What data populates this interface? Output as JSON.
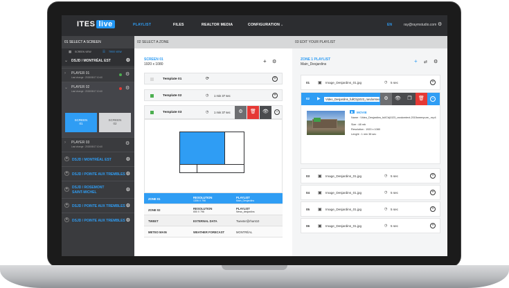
{
  "app": {
    "logo_main": "ITES",
    "logo_accent": "live"
  },
  "nav": {
    "items": [
      "PLAYLIST",
      "FILES",
      "REALTOR MEDIA",
      "CONFIGURATION"
    ],
    "lang": "EN",
    "email": "ray@raymstudio.com"
  },
  "col1": {
    "header": "01  SELECT A SCREEN",
    "toggle": [
      "SCREEN VIEW",
      "TREE VIEW"
    ],
    "top_site": "DSJD / MONTRÉAL EST",
    "players": [
      {
        "name": "PLAYER 01",
        "sub": "Last change : 2015/05/17 10:40",
        "status": "#4caf50"
      },
      {
        "name": "PLAYER 02",
        "sub": "Last change : 2015/05/17 10:40",
        "status": "#e53935"
      },
      {
        "name": "PLAYER 03",
        "sub": "Last change : 2015/05/17 10:40",
        "status": ""
      }
    ],
    "screens": [
      {
        "label": "SCREEN",
        "num": "01"
      },
      {
        "label": "SCREEN",
        "num": "02"
      }
    ],
    "sites": [
      "DSJD / MONTRÉAL EST",
      "DSJD / POINTE AUX TREMBLES",
      "DSJD / ROSEMONT SAINT-MICHEL",
      "DSJD / POINTE AUX TREMBLES",
      "DSJD / POINTE AUX TREMBLES"
    ]
  },
  "col2": {
    "header": "02  SELECT A ZONE",
    "screen_title": "SCREEN 01",
    "resolution": "1920 x 1080",
    "templates": [
      {
        "name": "Template 01",
        "duration": "",
        "color": "#d9d9d9"
      },
      {
        "name": "Template 02",
        "duration": "1 min 37 sec",
        "color": "#4caf50"
      },
      {
        "name": "Template 03",
        "duration": "1 min 37 sec",
        "color": "#4caf50"
      }
    ],
    "zones": [
      {
        "zone": "ZONE 01",
        "k1": "RESOLUTION",
        "v1": "1306 X 796",
        "k2": "PLAYLIST",
        "v2": "Main_Desjardins"
      },
      {
        "zone": "ZONE 02",
        "k1": "RESOLUTION",
        "v1": "650 X 796",
        "k2": "PLAYLIST",
        "v2": "News_desjardins"
      },
      {
        "zone": "TWEET",
        "k1": "EXTERNAL DATA",
        "v1": "",
        "k2": "Tweeter@rhant10",
        "v2": ""
      },
      {
        "zone": "METEO MAIN",
        "k1": "WEATHER FORECAST",
        "v1": "",
        "k2": "MONTRÉAL",
        "v2": ""
      }
    ]
  },
  "col3": {
    "header": "03  EDIT YOUR PLAYLIST",
    "playlist_label": "ZONE 1 PLAYLIST",
    "playlist_name": "Main_Desjardins",
    "rows": [
      {
        "n": "01",
        "file": "Image_Desjardins_01.jpg",
        "sec": "5 sec"
      },
      {
        "n": "02",
        "file": "Video_Desjardins_fullCbj1023_randomtext-2015...",
        "sec": ""
      },
      {
        "n": "03",
        "file": "Image_Desjardins_01.jpg",
        "sec": "5 sec"
      },
      {
        "n": "04",
        "file": "Image_Desjardins_01.jpg",
        "sec": "5 sec"
      },
      {
        "n": "05",
        "file": "Image_Desjardins_01.jpg",
        "sec": "5 sec"
      },
      {
        "n": "06",
        "file": "Image_Desjardins_01.jpg",
        "sec": "5 sec"
      }
    ],
    "details": {
      "type": "MOVIE",
      "name": "Name : Video_Desjardins_fullCbj1023_randomtext-2015sreenpure_.mp4",
      "size": "Size : 48 mb",
      "resolution": "Resolution : 1920 x 1080",
      "length": "Lenght : 1 min 38 sec"
    }
  },
  "colors": {
    "accent": "#2f9df4",
    "danger": "#e53935",
    "dark": "#2c2d30"
  }
}
